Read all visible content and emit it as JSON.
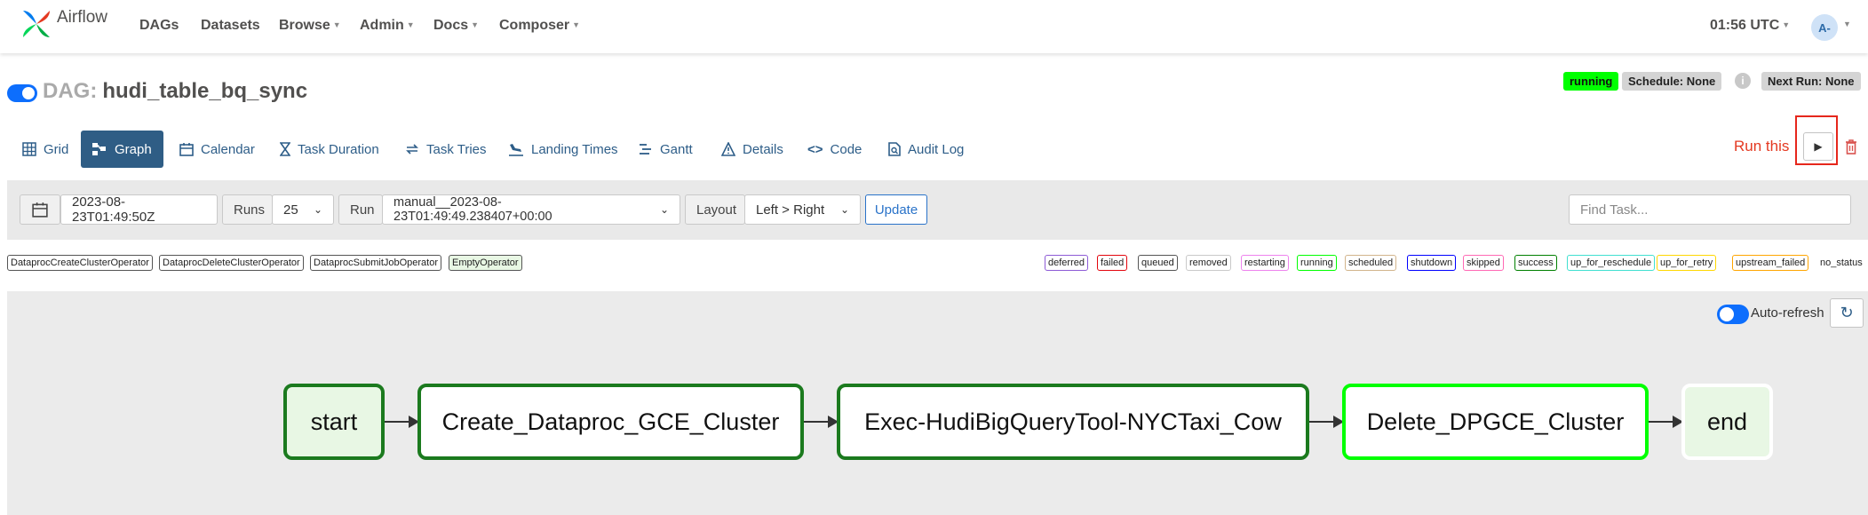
{
  "app": {
    "name": "Airflow"
  },
  "nav": {
    "dags": "DAGs",
    "datasets": "Datasets",
    "browse": "Browse",
    "admin": "Admin",
    "docs": "Docs",
    "composer": "Composer",
    "clock": "01:56 UTC",
    "avatar": "A-"
  },
  "dag": {
    "prefix": "DAG:",
    "name": "hudi_table_bq_sync",
    "status": "running",
    "schedule": "Schedule: None",
    "next_run": "Next Run: None"
  },
  "tabs": [
    {
      "label": "Grid",
      "icon": "grid-icon"
    },
    {
      "label": "Graph",
      "icon": "graph-icon",
      "active": true
    },
    {
      "label": "Calendar",
      "icon": "calendar-icon"
    },
    {
      "label": "Task Duration",
      "icon": "hourglass-icon"
    },
    {
      "label": "Task Tries",
      "icon": "retry-icon"
    },
    {
      "label": "Landing Times",
      "icon": "landing-icon"
    },
    {
      "label": "Gantt",
      "icon": "gantt-icon"
    },
    {
      "label": "Details",
      "icon": "warning-icon"
    },
    {
      "label": "Code",
      "icon": "code-icon"
    },
    {
      "label": "Audit Log",
      "icon": "audit-icon"
    }
  ],
  "actions": {
    "run_this": "Run this"
  },
  "filters": {
    "base_date": "2023-08-23T01:49:50Z",
    "runs_label": "Runs",
    "runs_value": "25",
    "run_label": "Run",
    "run_value": "manual__2023-08-23T01:49:49.238407+00:00",
    "layout_label": "Layout",
    "layout_value": "Left > Right",
    "update": "Update",
    "find_placeholder": "Find Task..."
  },
  "operators": [
    "DataprocCreateClusterOperator",
    "DataprocDeleteClusterOperator",
    "DataprocSubmitJobOperator",
    "EmptyOperator"
  ],
  "states": [
    {
      "label": "deferred",
      "color": "#8d5bd6"
    },
    {
      "label": "failed",
      "color": "#e3050d"
    },
    {
      "label": "queued",
      "color": "#555555"
    },
    {
      "label": "removed",
      "color": "#c9c9c9"
    },
    {
      "label": "restarting",
      "color": "#ee82ee"
    },
    {
      "label": "running",
      "color": "#00ff00"
    },
    {
      "label": "scheduled",
      "color": "#d2b48c"
    },
    {
      "label": "shutdown",
      "color": "#0000ff"
    },
    {
      "label": "skipped",
      "color": "#ff69b4"
    },
    {
      "label": "success",
      "color": "#008000"
    },
    {
      "label": "up_for_reschedule",
      "color": "#40e0d0"
    },
    {
      "label": "up_for_retry",
      "color": "#ffd700"
    },
    {
      "label": "upstream_failed",
      "color": "#ffa500"
    },
    {
      "label": "no_status",
      "color": ""
    }
  ],
  "graph": {
    "auto_refresh": "Auto-refresh",
    "nodes": [
      {
        "label": "start",
        "state": "success"
      },
      {
        "label": "Create_Dataproc_GCE_Cluster",
        "state": "success"
      },
      {
        "label": "Exec-HudiBigQueryTool-NYCTaxi_Cow",
        "state": "success"
      },
      {
        "label": "Delete_DPGCE_Cluster",
        "state": "running"
      },
      {
        "label": "end",
        "state": "none"
      }
    ]
  }
}
